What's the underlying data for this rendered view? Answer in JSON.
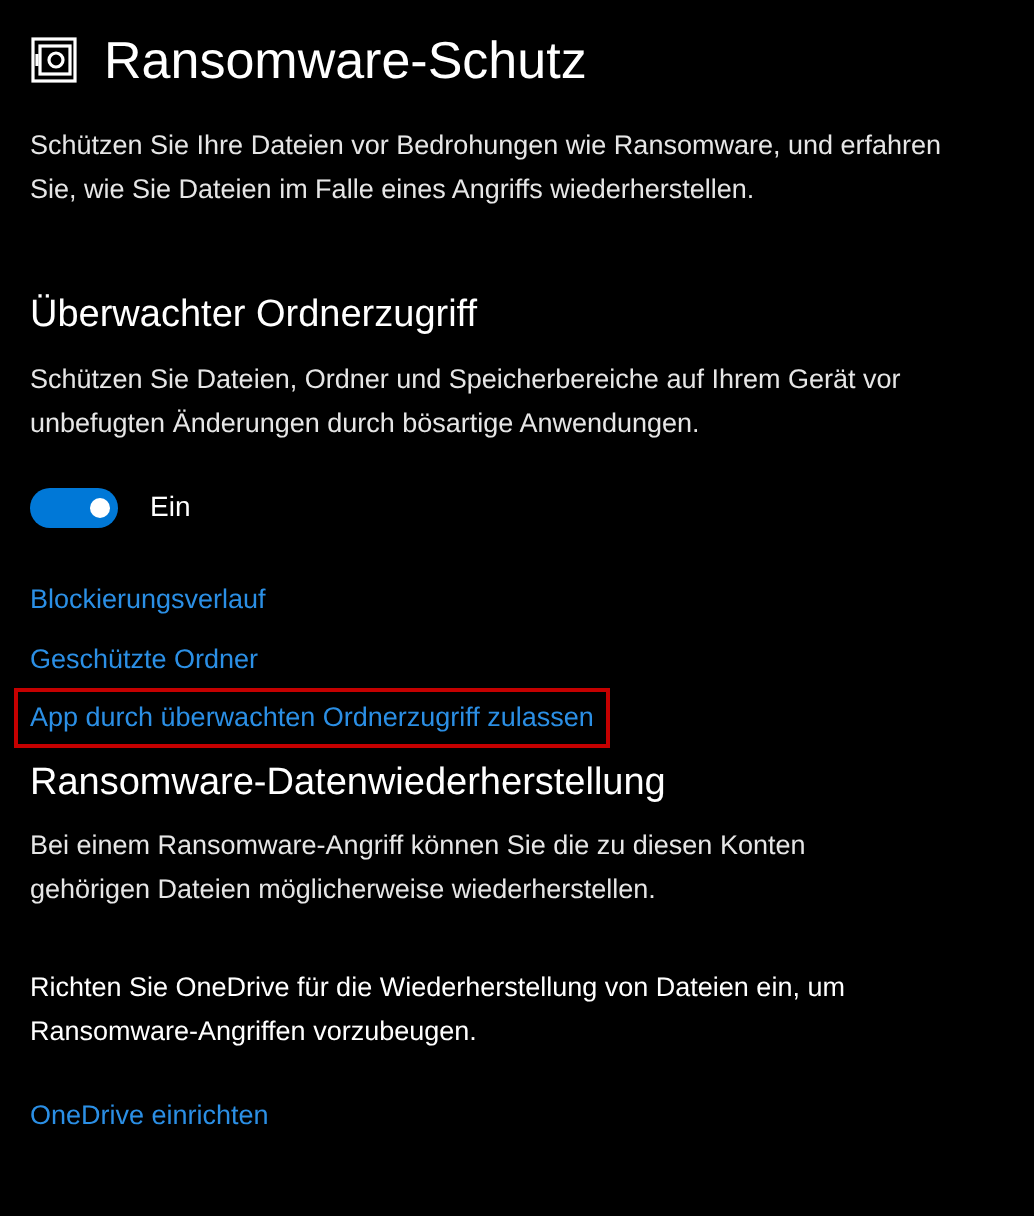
{
  "header": {
    "title": "Ransomware-Schutz",
    "description": "Schützen Sie Ihre Dateien vor Bedrohungen wie Ransomware, und erfahren Sie, wie Sie Dateien im Falle eines Angriffs wiederherstellen."
  },
  "folder_access": {
    "title": "Überwachter Ordnerzugriff",
    "description": "Schützen Sie Dateien, Ordner und Speicherbereiche auf Ihrem Gerät vor unbefugten Änderungen durch bösartige Anwendungen.",
    "toggle": {
      "on": true,
      "label": "Ein"
    },
    "links": [
      {
        "label": "Blockierungsverlauf",
        "highlighted": false
      },
      {
        "label": "Geschützte Ordner",
        "highlighted": false
      },
      {
        "label": "App durch überwachten Ordnerzugriff zulassen",
        "highlighted": true
      }
    ]
  },
  "recovery": {
    "title": "Ransomware-Datenwiederherstellung",
    "description": "Bei einem Ransomware-Angriff können Sie die zu diesen Konten gehörigen Dateien möglicherweise wiederherstellen.",
    "note": "Richten Sie OneDrive für die Wiederherstellung von Dateien ein, um Ransomware-Angriffen vorzubeugen.",
    "link": "OneDrive einrichten"
  }
}
